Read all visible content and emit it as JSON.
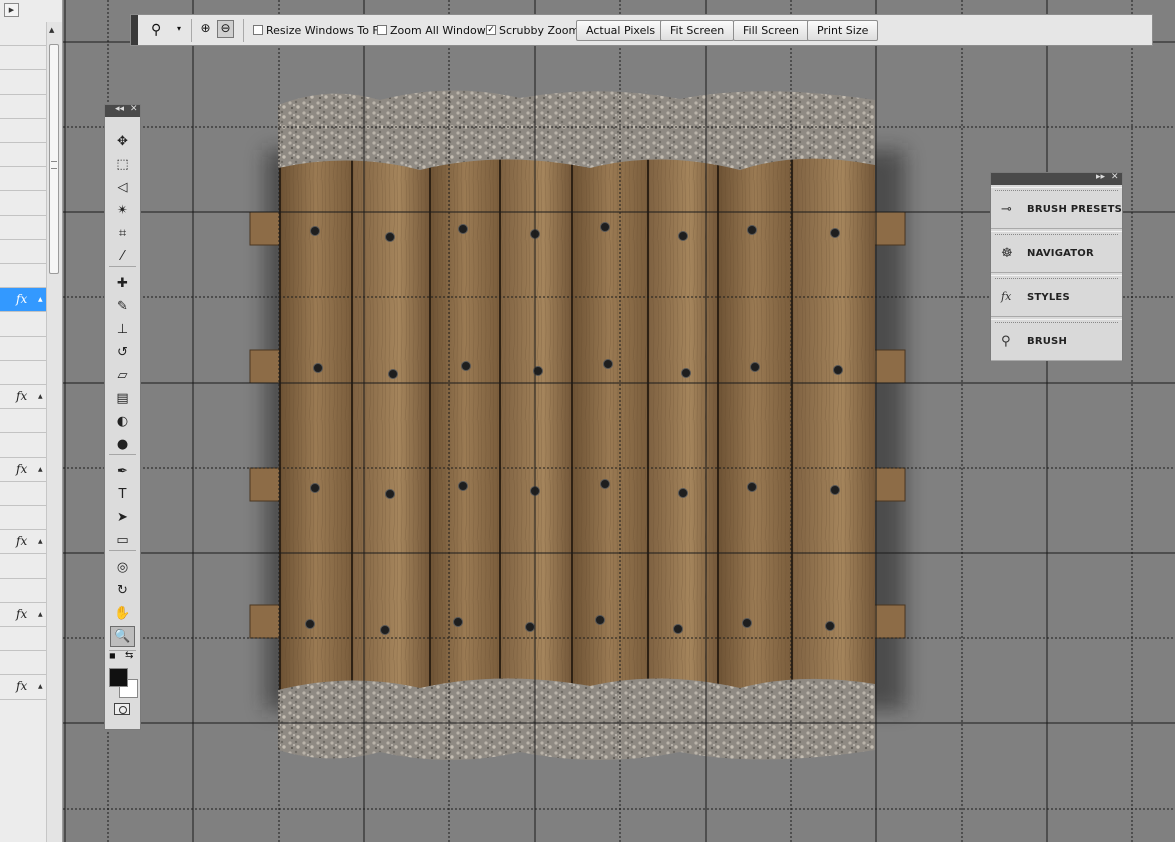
{
  "layers_panel": {
    "rows": [
      {
        "fx": "",
        "selected": false
      },
      {
        "fx": "",
        "selected": false
      },
      {
        "fx": "",
        "selected": false
      },
      {
        "fx": "",
        "selected": false
      },
      {
        "fx": "",
        "selected": false
      },
      {
        "fx": "",
        "selected": false
      },
      {
        "fx": "",
        "selected": false
      },
      {
        "fx": "",
        "selected": false
      },
      {
        "fx": "",
        "selected": false
      },
      {
        "fx": "",
        "selected": false
      },
      {
        "fx": "",
        "selected": false
      },
      {
        "fx": "fx",
        "selected": true
      },
      {
        "fx": "",
        "selected": false
      },
      {
        "fx": "",
        "selected": false
      },
      {
        "fx": "",
        "selected": false
      },
      {
        "fx": "fx",
        "selected": false
      },
      {
        "fx": "",
        "selected": false
      },
      {
        "fx": "",
        "selected": false
      },
      {
        "fx": "fx",
        "selected": false
      },
      {
        "fx": "",
        "selected": false
      },
      {
        "fx": "",
        "selected": false
      },
      {
        "fx": "fx",
        "selected": false
      },
      {
        "fx": "",
        "selected": false
      },
      {
        "fx": "",
        "selected": false
      },
      {
        "fx": "fx",
        "selected": false
      },
      {
        "fx": "",
        "selected": false
      },
      {
        "fx": "",
        "selected": false
      },
      {
        "fx": "fx",
        "selected": false
      }
    ],
    "colors": {
      "selected": "#3399ff",
      "background": "#ececec"
    }
  },
  "options_bar": {
    "tool_icon": "zoom-icon",
    "zoom_in_icon": "zoom-in-icon",
    "zoom_out_icon": "zoom-out-icon",
    "checkboxes": [
      {
        "label": "Resize Windows To Fit",
        "checked": false
      },
      {
        "label": "Zoom All Windows",
        "checked": false
      },
      {
        "label": "Scrubby Zoom",
        "checked": true
      }
    ],
    "buttons": [
      "Actual Pixels",
      "Fit Screen",
      "Fill Screen",
      "Print Size"
    ]
  },
  "tools": [
    {
      "name": "move-tool",
      "glyph": "✥"
    },
    {
      "name": "marquee-tool",
      "glyph": "⬚"
    },
    {
      "name": "lasso-tool",
      "glyph": "◁"
    },
    {
      "name": "magic-wand-tool",
      "glyph": "✴"
    },
    {
      "name": "crop-tool",
      "glyph": "⌗"
    },
    {
      "name": "eyedropper-tool",
      "glyph": "⁄"
    },
    {
      "name": "healing-brush-tool",
      "glyph": "✚"
    },
    {
      "name": "brush-tool",
      "glyph": "✎"
    },
    {
      "name": "clone-stamp-tool",
      "glyph": "⊥"
    },
    {
      "name": "history-brush-tool",
      "glyph": "↺"
    },
    {
      "name": "eraser-tool",
      "glyph": "▱"
    },
    {
      "name": "gradient-tool",
      "glyph": "▤"
    },
    {
      "name": "blur-tool",
      "glyph": "◐"
    },
    {
      "name": "dodge-tool",
      "glyph": "●"
    },
    {
      "name": "pen-tool",
      "glyph": "✒"
    },
    {
      "name": "type-tool",
      "glyph": "T"
    },
    {
      "name": "path-selection-tool",
      "glyph": "➤"
    },
    {
      "name": "rectangle-tool",
      "glyph": "▭"
    },
    {
      "name": "3d-rotate-tool",
      "glyph": "◎"
    },
    {
      "name": "3d-orbit-tool",
      "glyph": "↻"
    },
    {
      "name": "hand-tool",
      "glyph": "✋"
    },
    {
      "name": "zoom-tool",
      "glyph": "🔍",
      "active": true
    }
  ],
  "panel_dock": {
    "items": [
      {
        "label": "BRUSH PRESETS",
        "icon": "brush-presets-icon",
        "glyph": "⊸"
      },
      {
        "label": "NAVIGATOR",
        "icon": "navigator-icon",
        "glyph": "☸"
      },
      {
        "label": "STYLES",
        "icon": "styles-icon",
        "glyph": "fx"
      },
      {
        "label": "BRUSH",
        "icon": "brush-icon",
        "glyph": "⚲"
      }
    ]
  },
  "canvas": {
    "image": "wooden-plank-floor-tile",
    "colors": {
      "background": "#808080",
      "wood": "#8a6a45",
      "gravel": "#a09a90"
    }
  }
}
